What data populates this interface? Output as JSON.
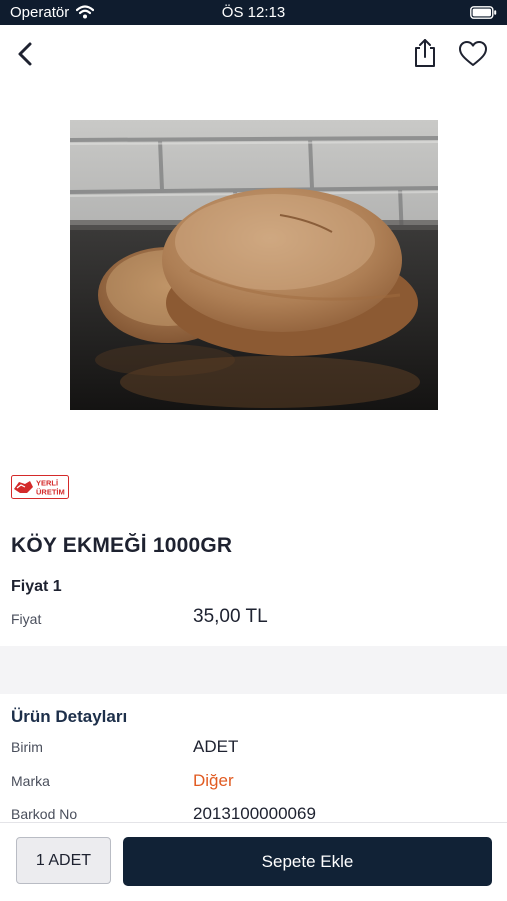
{
  "status_bar": {
    "carrier": "Operatör",
    "time": "ÖS 12:13"
  },
  "nav": {
    "back_icon": "chevron-left-icon",
    "share_icon": "share-icon",
    "favorite_icon": "heart-icon"
  },
  "product": {
    "image": "bread-photo",
    "badge_text": "YERLİ ÜRETİM",
    "title": "KÖY EKMEĞİ 1000GR",
    "price_heading": "Fiyat 1",
    "price_label": "Fiyat",
    "price_value": "35,00 TL"
  },
  "details": {
    "heading": "Ürün Detayları",
    "rows": [
      {
        "label": "Birim",
        "value": "ADET"
      },
      {
        "label": "Marka",
        "value": "Diğer"
      },
      {
        "label": "Barkod No",
        "value": "2013100000069"
      }
    ]
  },
  "bottom_bar": {
    "quantity_label": "1 ADET",
    "add_to_cart_label": "Sepete Ekle"
  },
  "colors": {
    "status_bar": "#0f1c2e",
    "primary_button": "#112236",
    "brand_accent": "#e15b22",
    "badge_red": "#d42a2a"
  }
}
